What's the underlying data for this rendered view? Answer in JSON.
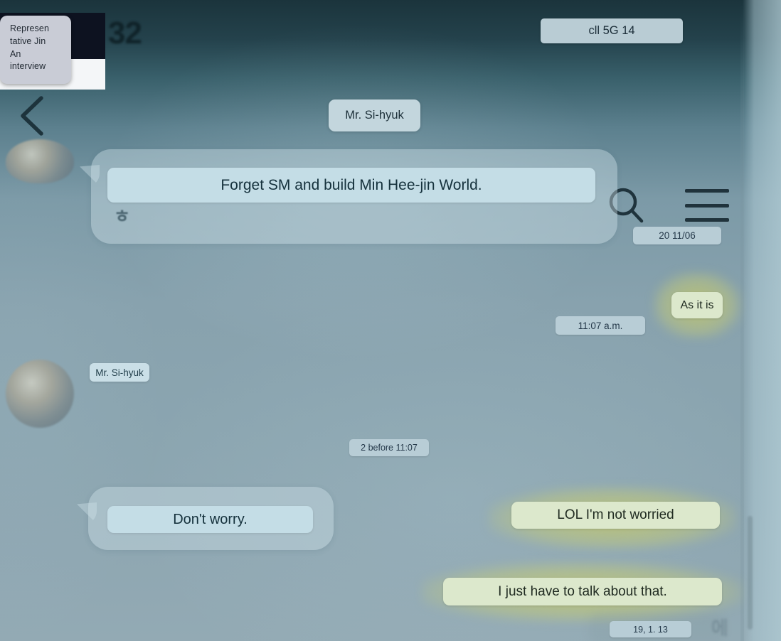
{
  "overlay": {
    "card_text": "Represen\ntative Jin\nAn\ninterview",
    "blurred_title": "32",
    "card_name": "representative-jin-interview-card"
  },
  "status_bar": {
    "text": "cll 5G 14"
  },
  "header": {
    "title": "Mr. Si-hyuk",
    "back_icon": "chevron-left-icon",
    "search_icon": "search-icon",
    "menu_icon": "hamburger-menu-icon"
  },
  "colors": {
    "background_top": "#1b343c",
    "background_bottom": "#93aab4",
    "incoming_bubble": "#c4dde6",
    "outgoing_bubble": "#dce8cc",
    "outgoing_glow": "#cbcc60",
    "timestamp_pill": "#b8cdd6",
    "header_text": "#1d3039"
  },
  "messages": [
    {
      "id": "msg-forget-sm",
      "side": "incoming",
      "text": "Forget SM and build Min Hee-jin World.",
      "reaction": "ㅎ",
      "timestamp": "20 11/06"
    },
    {
      "id": "msg-as-it-is",
      "side": "outgoing",
      "text": "As it is",
      "timestamp": "11:07 a.m."
    },
    {
      "id": "msg-dont-worry",
      "side": "incoming",
      "sender": "Mr. Si-hyuk",
      "text": "Don't worry.",
      "timestamp": "2 before 11:07"
    },
    {
      "id": "msg-lol-not-worried",
      "side": "outgoing",
      "text": "LOL I'm not worried",
      "timestamp": ""
    },
    {
      "id": "msg-talk-about-that",
      "side": "outgoing",
      "text": "I just have to talk about that.",
      "timestamp": "19, 1. 13"
    }
  ],
  "partial_bottom": {
    "glyph": "에"
  }
}
